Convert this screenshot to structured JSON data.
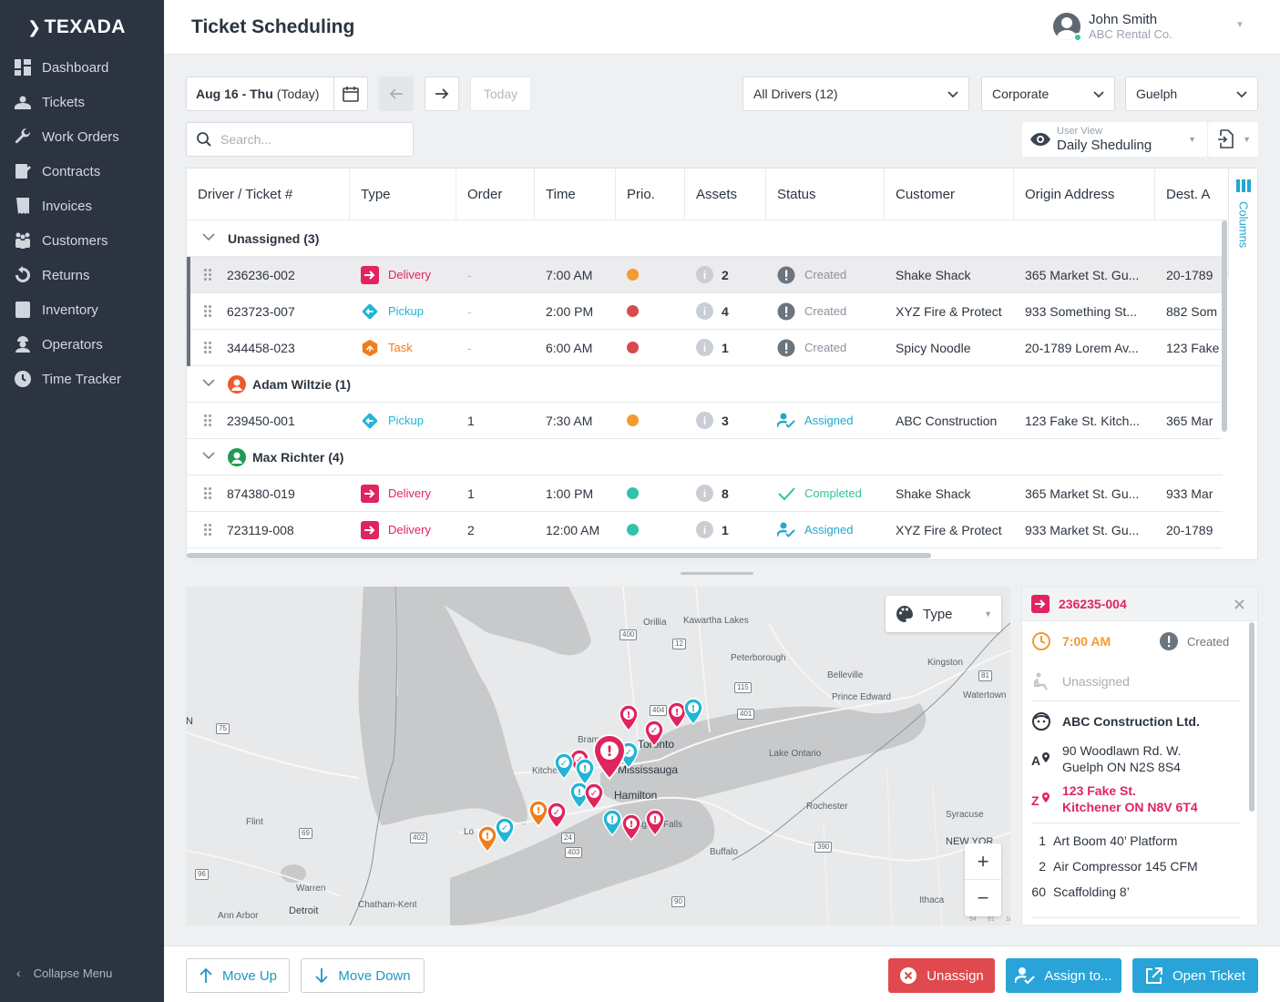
{
  "app": {
    "logo": "TEXADA"
  },
  "sidebar": {
    "items": [
      {
        "label": "Dashboard",
        "icon": "dashboard-icon"
      },
      {
        "label": "Tickets",
        "icon": "tickets-icon"
      },
      {
        "label": "Work Orders",
        "icon": "wrench-icon"
      },
      {
        "label": "Contracts",
        "icon": "contracts-icon"
      },
      {
        "label": "Invoices",
        "icon": "invoices-icon"
      },
      {
        "label": "Customers",
        "icon": "customers-icon"
      },
      {
        "label": "Returns",
        "icon": "returns-icon"
      },
      {
        "label": "Inventory",
        "icon": "inventory-icon"
      },
      {
        "label": "Operators",
        "icon": "operators-icon"
      },
      {
        "label": "Time Tracker",
        "icon": "clock-icon"
      }
    ],
    "collapse_label": "Collapse Menu"
  },
  "header": {
    "title": "Ticket Scheduling",
    "user_name": "John Smith",
    "user_org": "ABC Rental Co."
  },
  "toolbar": {
    "date_bold": "Aug 16 - Thu",
    "date_suffix": "(Today)",
    "today_label": "Today",
    "drivers_select": "All Drivers (12)",
    "region_select": "Corporate",
    "branch_select": "Guelph",
    "search_placeholder": "Search...",
    "view_label": "User View",
    "view_value": "Daily Sheduling"
  },
  "table": {
    "columns": [
      "Driver / Ticket #",
      "Type",
      "Order",
      "Time",
      "Prio.",
      "Assets",
      "Status",
      "Customer",
      "Origin Address",
      "Dest. A"
    ],
    "columns_tab": "Columns",
    "groups": [
      {
        "label": "Unassigned (3)",
        "rows": [
          {
            "ticket": "236236-002",
            "type": "Delivery",
            "order": "-",
            "time": "7:00 AM",
            "prio": "orange",
            "assets": "2",
            "status": "Created",
            "customer": "Shake Shack",
            "origin": "365 Market St. Gu...",
            "dest": "20-1789"
          },
          {
            "ticket": "623723-007",
            "type": "Pickup",
            "order": "-",
            "time": "2:00 PM",
            "prio": "red",
            "assets": "4",
            "status": "Created",
            "customer": "XYZ Fire & Protect",
            "origin": "933 Something St...",
            "dest": "882 Som"
          },
          {
            "ticket": "344458-023",
            "type": "Task",
            "order": "-",
            "time": "6:00 AM",
            "prio": "red",
            "assets": "1",
            "status": "Created",
            "customer": "Spicy Noodle",
            "origin": "20-1789 Lorem Av...",
            "dest": "123 Fake"
          }
        ]
      },
      {
        "label": "Adam Wiltzie (1)",
        "rows": [
          {
            "ticket": "239450-001",
            "type": "Pickup",
            "order": "1",
            "time": "7:30 AM",
            "prio": "orange",
            "assets": "3",
            "status": "Assigned",
            "customer": "ABC Construction",
            "origin": "123 Fake St. Kitch...",
            "dest": "365 Mar"
          }
        ]
      },
      {
        "label": "Max Richter (4)",
        "rows": [
          {
            "ticket": "874380-019",
            "type": "Delivery",
            "order": "1",
            "time": "1:00 PM",
            "prio": "teal",
            "assets": "8",
            "status": "Completed",
            "customer": "Shake Shack",
            "origin": "365 Market St. Gu...",
            "dest": "933 Mar"
          },
          {
            "ticket": "723119-008",
            "type": "Delivery",
            "order": "2",
            "time": "12:00 AM",
            "prio": "teal",
            "assets": "1",
            "status": "Assigned",
            "customer": "XYZ Fire & Protect",
            "origin": "933 Market St. Gu...",
            "dest": "20-1789"
          }
        ]
      }
    ]
  },
  "map": {
    "type_select": "Type",
    "labels": [
      "Orillia",
      "Kawartha Lakes",
      "Peterborough",
      "Kingston",
      "Belleville",
      "Prince Edward",
      "Watertown",
      "Toronto",
      "Mississauga",
      "Kitchener",
      "Hamilton",
      "Lake Ontario",
      "Rochester",
      "Syracuse",
      "NEW YOR",
      "Buffalo",
      "Falls",
      "Flint",
      "Warren",
      "Detroit",
      "Ann Arbor",
      "Chatham-Kent",
      "Ithaca",
      "Bram",
      "N",
      "Lo",
      "agar"
    ],
    "shields": [
      "400",
      "12",
      "115",
      "401",
      "404",
      "37",
      "81",
      "75",
      "69",
      "402",
      "24",
      "403",
      "390",
      "96",
      "90",
      "94",
      "81",
      "10"
    ],
    "zoom_in": "+",
    "zoom_out": "−"
  },
  "detail": {
    "ticket": "236235-004",
    "time": "7:00 AM",
    "status": "Created",
    "driver": "Unassigned",
    "customer": "ABC Construction Ltd.",
    "origin_line1": "90 Woodlawn Rd. W.",
    "origin_line2": "Guelph ON N2S 8S4",
    "dest_line1": "123 Fake St.",
    "dest_line2": "Kitchener ON N8V 6T4",
    "assets": [
      {
        "qty": "1",
        "name": "Art Boom 40’ Platform"
      },
      {
        "qty": "2",
        "name": "Air Compressor 145 CFM"
      },
      {
        "qty": "60",
        "name": "Scaffolding 8’"
      }
    ]
  },
  "footer": {
    "move_up": "Move Up",
    "move_down": "Move Down",
    "unassign": "Unassign",
    "assign": "Assign to...",
    "open": "Open Ticket"
  },
  "colors": {
    "sidebar": "#2b3440",
    "delivery": "#e0245e",
    "pickup": "#21b5d6",
    "task": "#f07c1c",
    "assigned": "#21a7cf",
    "completed": "#2ec4a0",
    "unassign_button": "#e0494d",
    "primary_button": "#2aa4d8"
  }
}
